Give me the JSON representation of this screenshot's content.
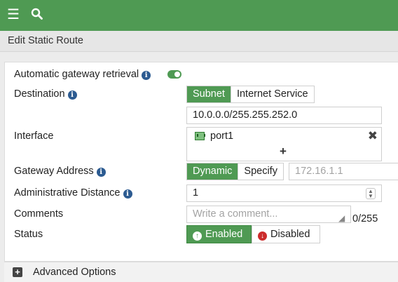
{
  "topbar": {
    "menu_icon": "hamburger-icon",
    "search_icon": "search-icon"
  },
  "page": {
    "title": "Edit Static Route"
  },
  "form": {
    "auto_gateway": {
      "label": "Automatic gateway retrieval",
      "enabled": true
    },
    "destination": {
      "label": "Destination",
      "options": [
        "Subnet",
        "Internet Service"
      ],
      "selected": "Subnet",
      "value": "10.0.0.0/255.255.252.0"
    },
    "interface": {
      "label": "Interface",
      "items": [
        {
          "name": "port1",
          "icon": "port-icon"
        }
      ],
      "add_icon": "plus-icon",
      "remove_icon": "close-icon"
    },
    "gateway": {
      "label": "Gateway Address",
      "options": [
        "Dynamic",
        "Specify"
      ],
      "selected": "Dynamic",
      "placeholder": "172.16.1.1"
    },
    "admin_distance": {
      "label": "Administrative Distance",
      "value": "1"
    },
    "comments": {
      "label": "Comments",
      "placeholder": "Write a comment...",
      "counter": "0/255"
    },
    "status": {
      "label": "Status",
      "options": [
        "Enabled",
        "Disabled"
      ],
      "selected": "Enabled"
    }
  },
  "advanced": {
    "label": "Advanced Options"
  },
  "colors": {
    "accent": "#4f9a53",
    "info": "#2c5b91",
    "disabled_icon": "#cc2b2b"
  }
}
